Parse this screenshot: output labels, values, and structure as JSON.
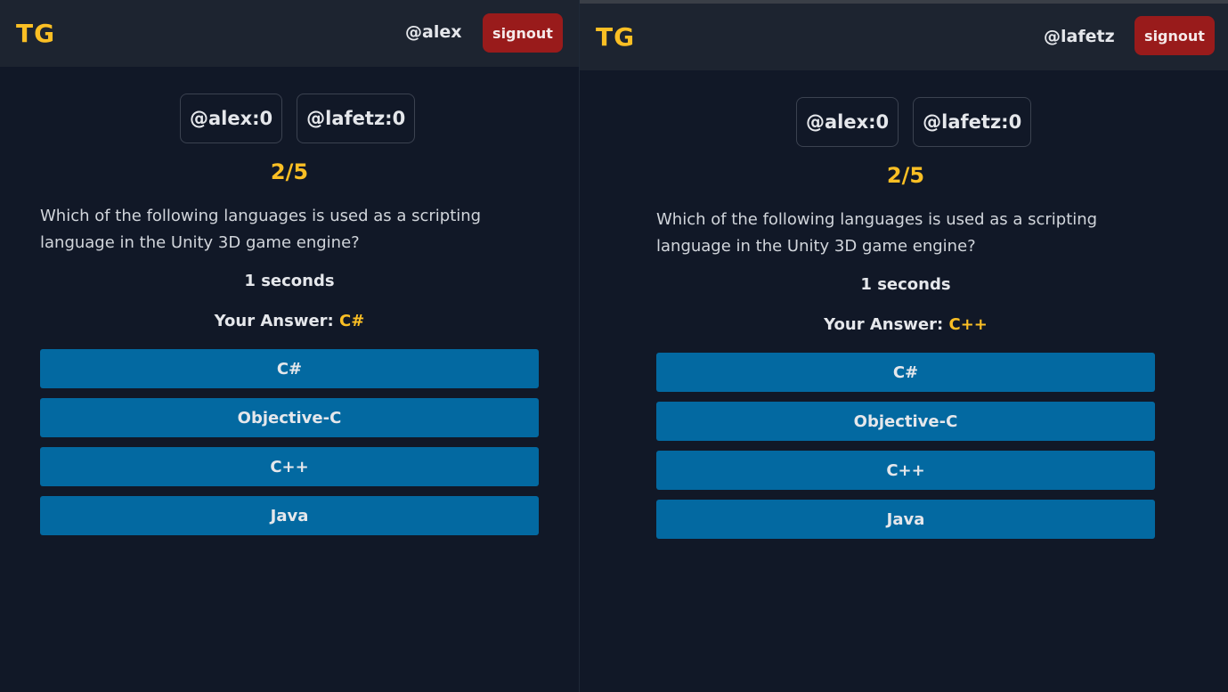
{
  "panes": [
    {
      "logo": "TG",
      "user_handle": "@alex",
      "signout_label": "signout",
      "scores": [
        "@alex:0",
        "@lafetz:0"
      ],
      "round": "2/5",
      "question": "Which of the following languages is used as a scripting language in the Unity 3D game engine?",
      "timer": "1 seconds",
      "your_answer_label": "Your Answer:",
      "your_answer_value": "C#",
      "options": [
        "C#",
        "Objective-C",
        "C++",
        "Java"
      ]
    },
    {
      "logo": "TG",
      "user_handle": "@lafetz",
      "signout_label": "signout",
      "scores": [
        "@alex:0",
        "@lafetz:0"
      ],
      "round": "2/5",
      "question": "Which of the following languages is used as a scripting language in the Unity 3D game engine?",
      "timer": "1 seconds",
      "your_answer_label": "Your Answer:",
      "your_answer_value": "C++",
      "options": [
        "C#",
        "Objective-C",
        "C++",
        "Java"
      ]
    }
  ],
  "colors": {
    "accent": "#fbbf24",
    "signout": "#991b1b",
    "option": "#0369a1",
    "navbar": "#1d2430",
    "background": "#111827"
  }
}
